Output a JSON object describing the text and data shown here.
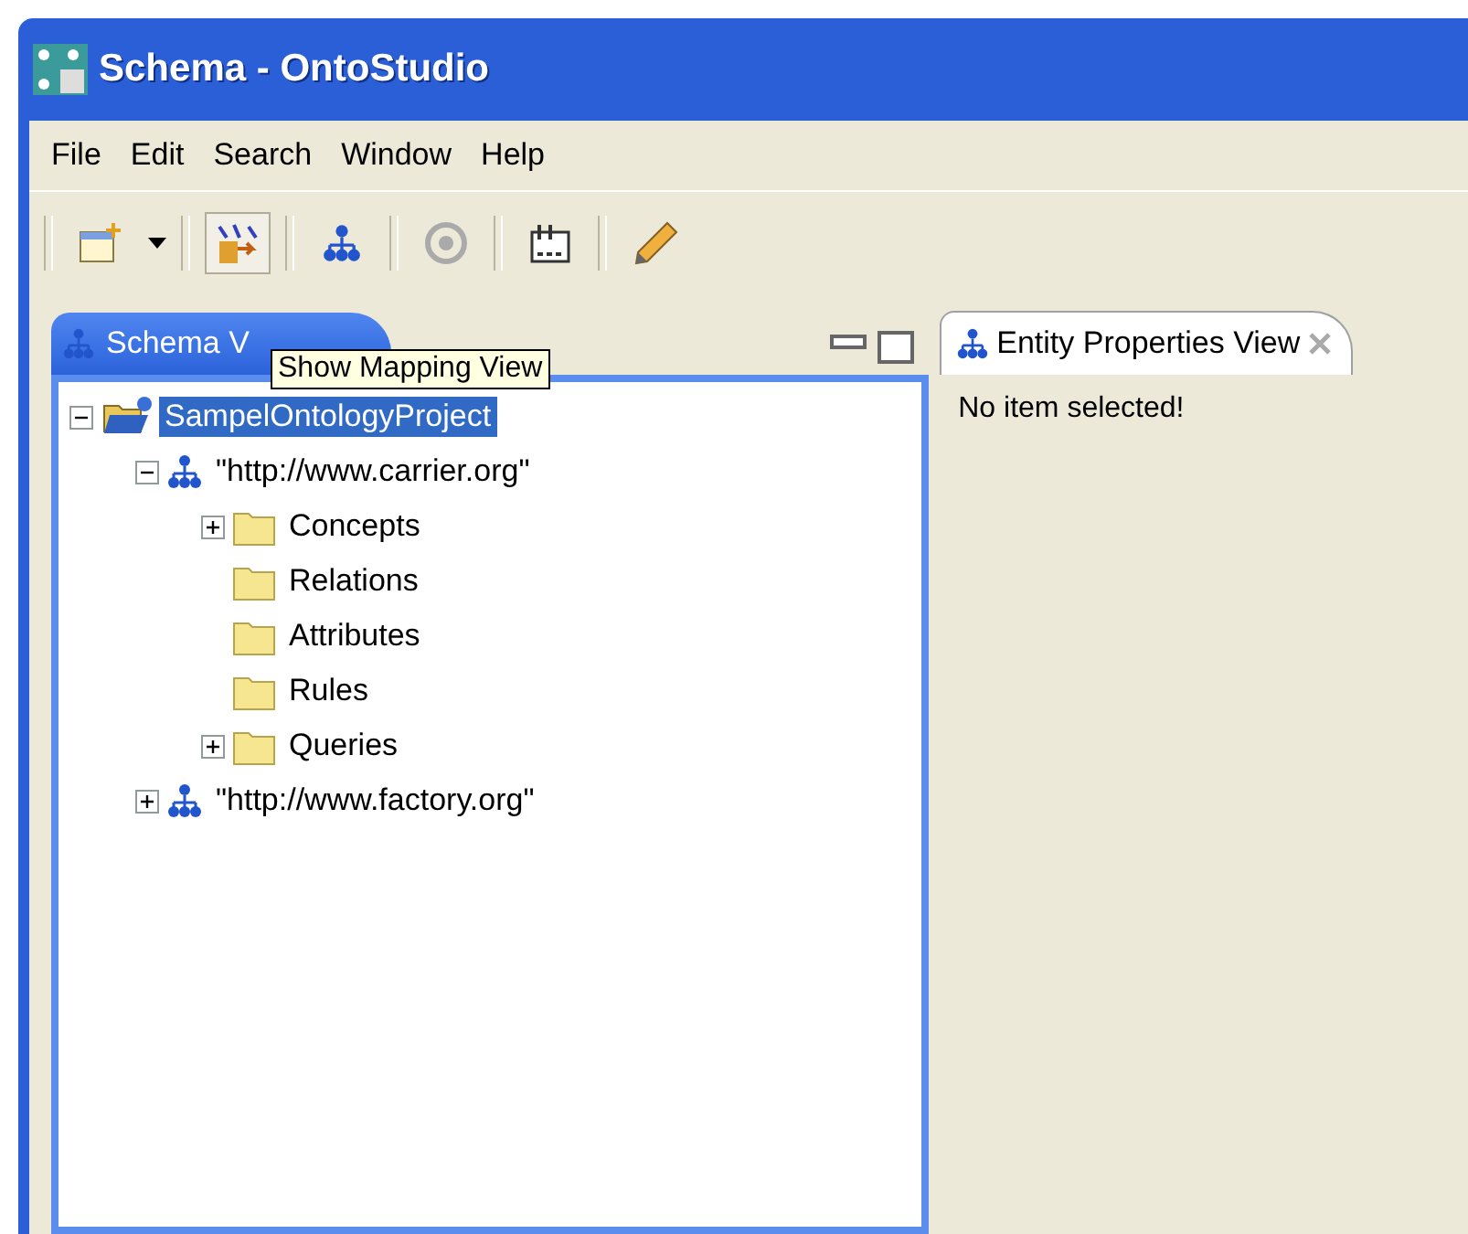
{
  "window": {
    "title": "Schema - OntoStudio"
  },
  "menu": [
    "File",
    "Edit",
    "Search",
    "Window",
    "Help"
  ],
  "tooltip": "Show Mapping View",
  "left_view": {
    "tab": "Schema V",
    "tree": [
      {
        "label": "SampelOntologyProject",
        "kind": "project",
        "expanded": true,
        "selected": true,
        "children": [
          {
            "label": "\"http://www.carrier.org\"",
            "kind": "ontology",
            "expanded": true,
            "selected": false,
            "children": [
              {
                "label": "Concepts",
                "kind": "folder",
                "expanded": false,
                "selected": false
              },
              {
                "label": "Relations",
                "kind": "folder",
                "selected": false
              },
              {
                "label": "Attributes",
                "kind": "folder",
                "selected": false
              },
              {
                "label": "Rules",
                "kind": "folder",
                "selected": false
              },
              {
                "label": "Queries",
                "kind": "folder",
                "expanded": false,
                "selected": false
              }
            ]
          },
          {
            "label": "\"http://www.factory.org\"",
            "kind": "ontology",
            "expanded": false,
            "selected": false
          }
        ]
      }
    ]
  },
  "right_view": {
    "tab": "Entity Properties View",
    "message": "No item selected!"
  }
}
